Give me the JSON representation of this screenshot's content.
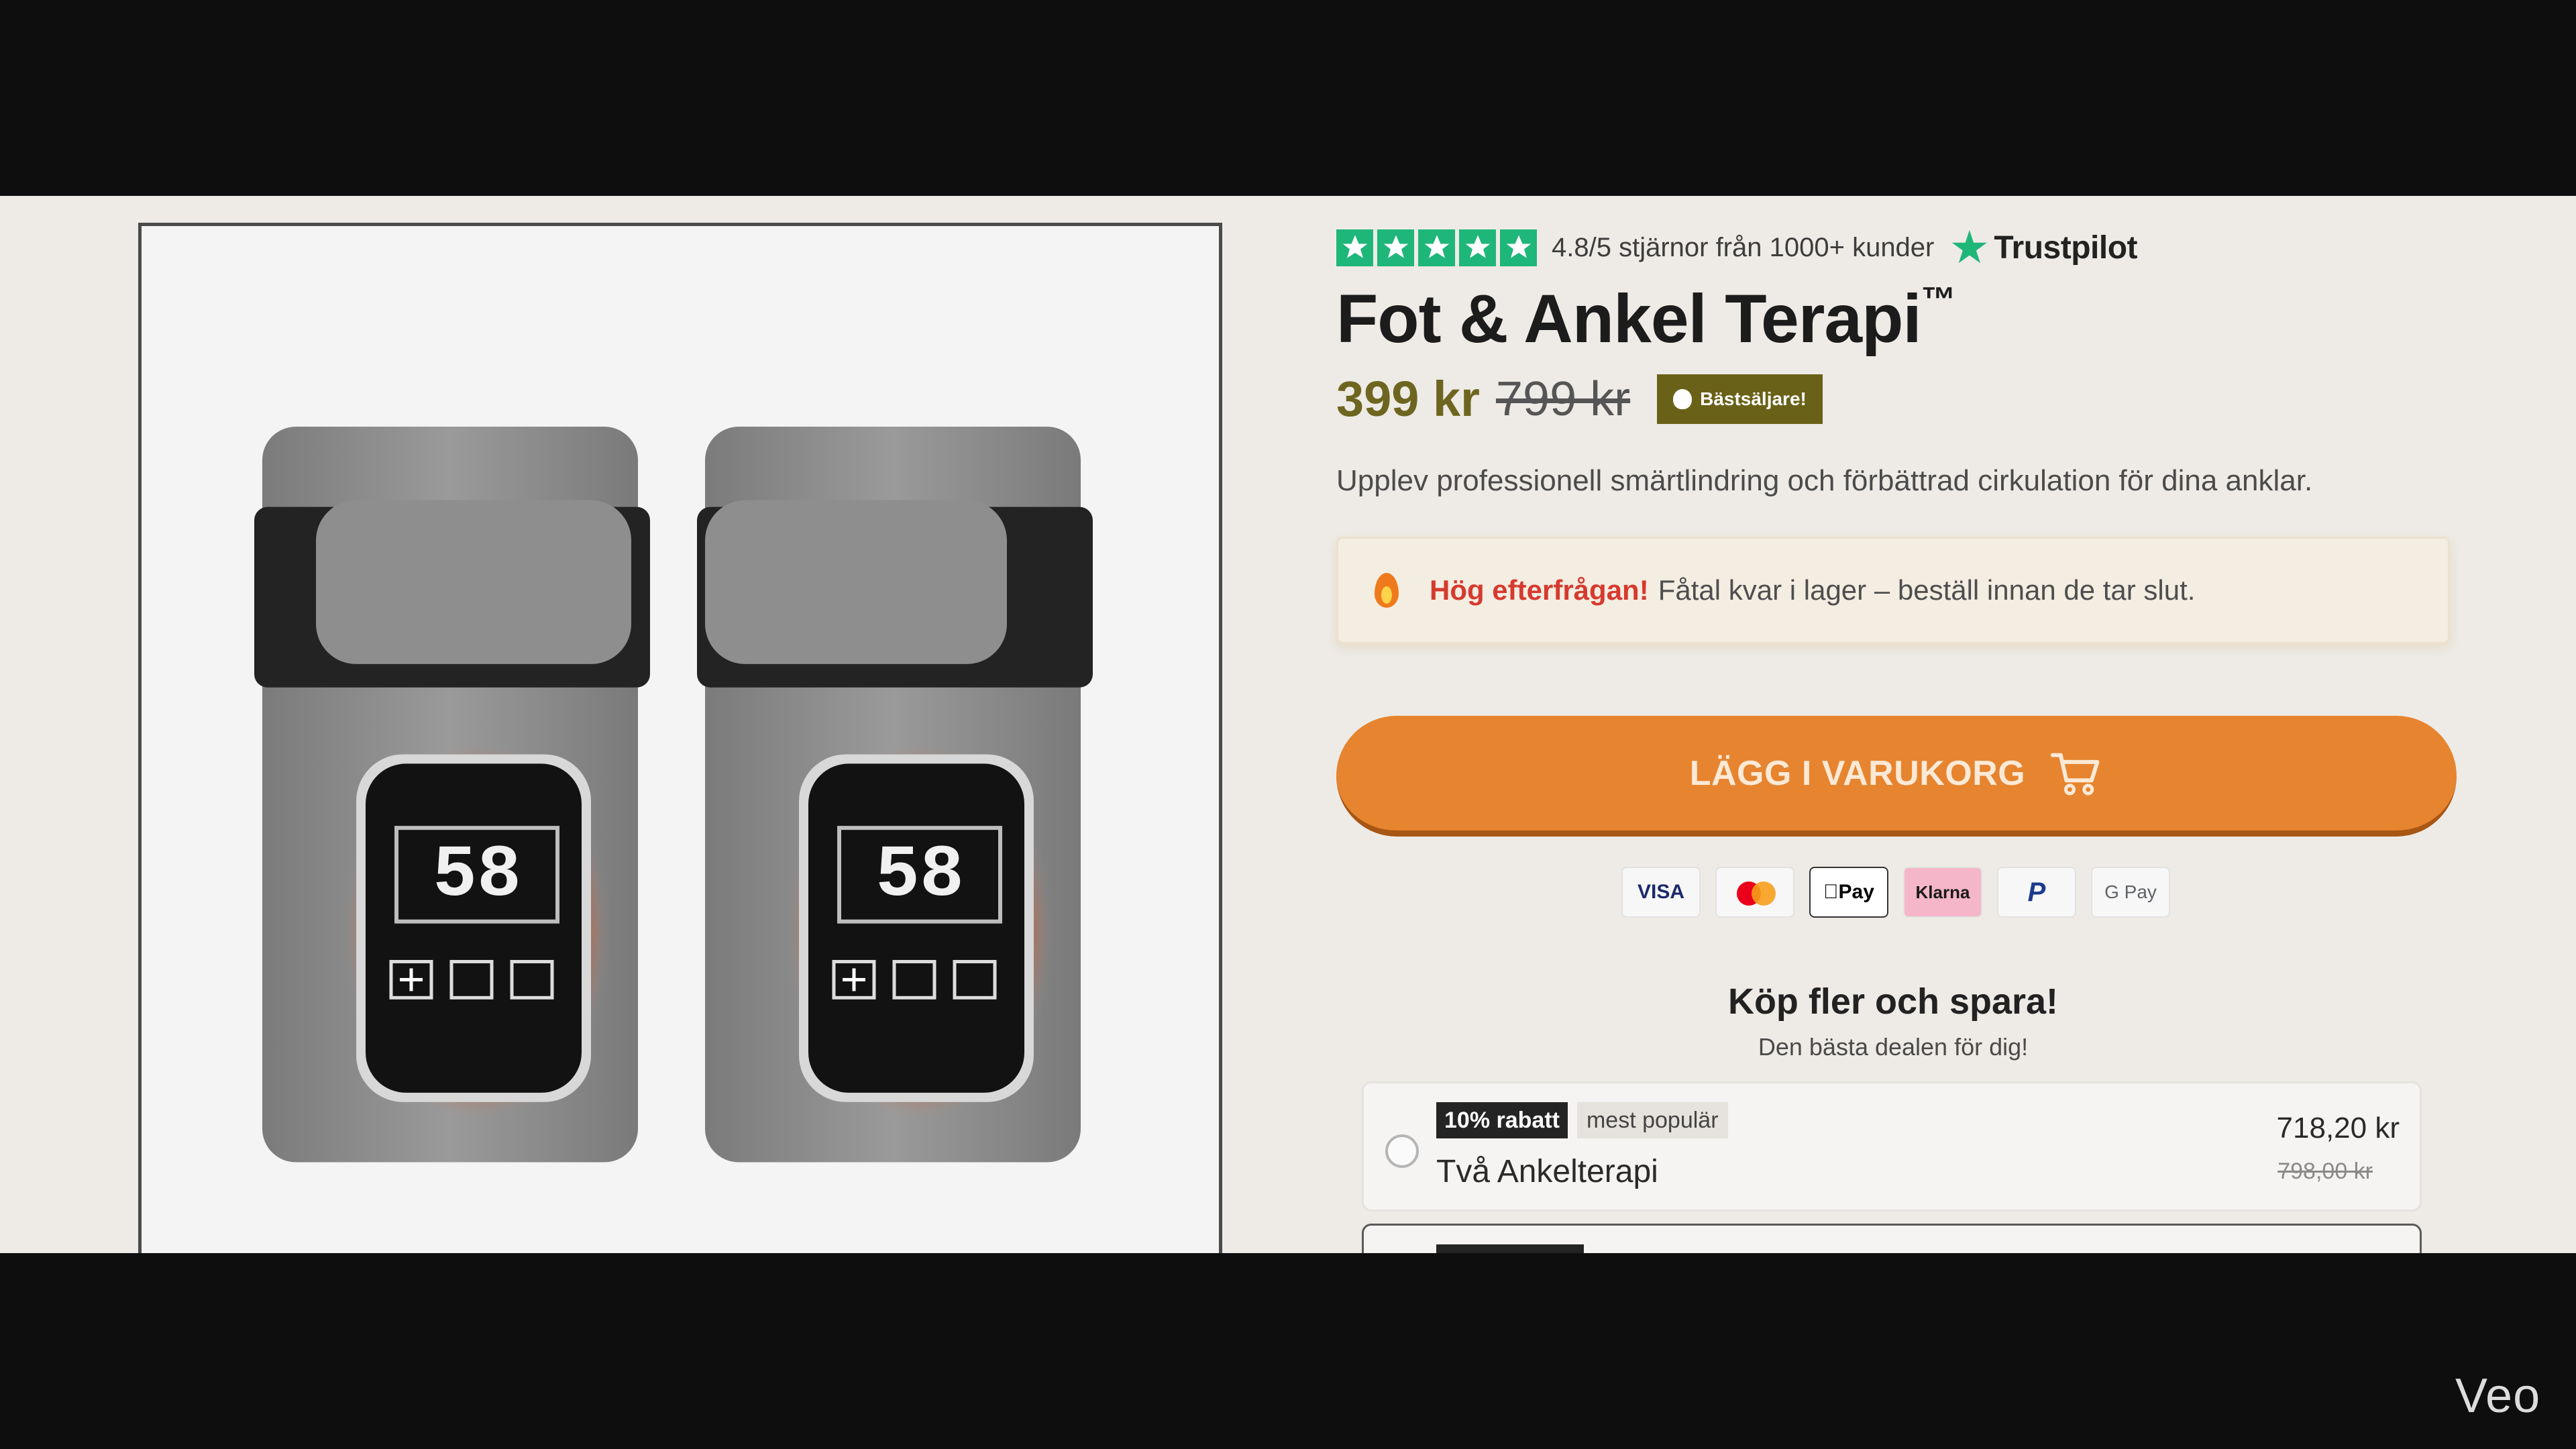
{
  "rating": {
    "stars": 5,
    "text": "4.8/5 stjärnor från 1000+ kunder",
    "provider": "Trustpilot",
    "color": "#1fb67a"
  },
  "product": {
    "title": "Fot & Ankel Terapi",
    "trademark": "™",
    "price": "399 kr",
    "old_price": "799 kr",
    "badge": "Bästsäljare!",
    "tagline": "Upplev professionell smärtlindring och förbättrad cirkulation för dina anklar.",
    "display_reading_left": "58",
    "display_reading_right": "58"
  },
  "demand": {
    "strong": "Hög efterfrågan!",
    "text": "Fåtal kvar i lager – beställ innan de tar slut."
  },
  "cart": {
    "label": "LÄGG I VARUKORG",
    "accent": "#e6842f"
  },
  "payment_methods": {
    "visa": "VISA",
    "apple_pay": "Pay",
    "klarna": "Klarna",
    "paypal": "P",
    "google_pay": "G Pay"
  },
  "bundles": {
    "heading": "Köp fler och spara!",
    "subheading": "Den bästa dealen för dig!",
    "offers": [
      {
        "discount": "10% rabatt",
        "tag": "mest populär",
        "name": "Två Ankelterapi",
        "price": "718,20 kr",
        "old_price": "798,00 kr",
        "selected": false
      }
    ]
  },
  "watermark": "Veo"
}
